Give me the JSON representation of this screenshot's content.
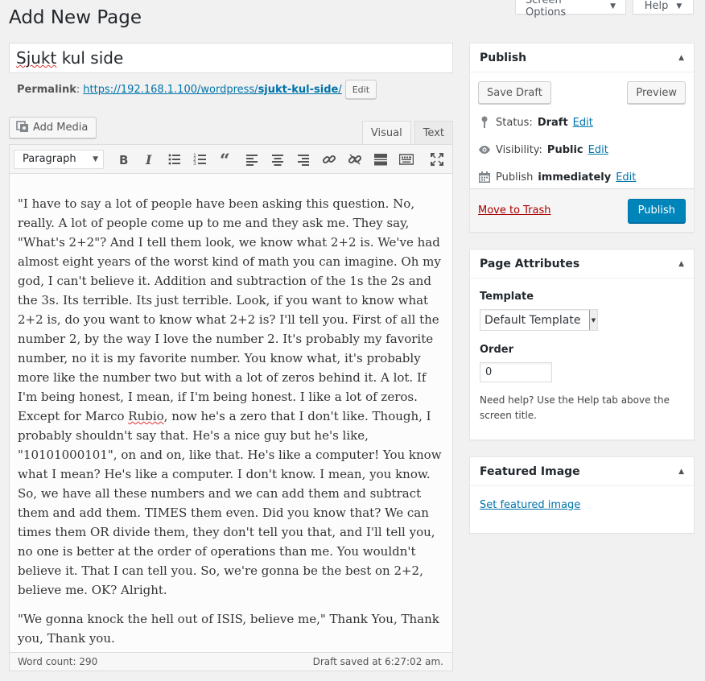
{
  "screen_meta": {
    "screen_options_label": "Screen Options",
    "help_label": "Help"
  },
  "page": {
    "heading": "Add New Page"
  },
  "title": {
    "value_word1": "Sjukt",
    "value_rest": " kul side"
  },
  "permalink": {
    "label": "Permalink",
    "url_base": "https://192.168.1.100/wordpress/",
    "slug": "sjukt-kul-side",
    "url_tail": "/",
    "edit_label": "Edit"
  },
  "media": {
    "add_media_label": "Add Media"
  },
  "editor_tabs": {
    "visual": "Visual",
    "text": "Text"
  },
  "toolbar": {
    "format_value": "Paragraph",
    "buttons": [
      "bold",
      "italic",
      "bulleted-list",
      "numbered-list",
      "blockquote",
      "align-left",
      "align-center",
      "align-right",
      "insert-link",
      "remove-link",
      "read-more",
      "toolbar-toggle",
      "fullscreen"
    ]
  },
  "content": {
    "p1_part1": "\"I have to say a lot of people have been asking this question. No, really. A lot of people come up to me and they ask me. They say, \"What's 2+2\"? And I tell them look, we know what 2+2 is. We've had almost eight years of the worst kind of math you can imagine. Oh my god, I can't believe it. Addition and subtraction of the 1s the 2s and the 3s. Its terrible. Its just terrible. Look, if you want to know what 2+2 is, do you want to know what 2+2 is? I'll tell you. First of all the number 2, by the way I love the number 2. It's probably my favorite number, no it is my favorite number. You know what, it's probably more like the number two but with a lot of zeros behind it. A lot. If I'm being honest, I mean, if I'm being honest. I like a lot of zeros. Except for Marco ",
    "p1_spell": "Rubio",
    "p1_part2": ", now he's a zero that I don't like. Though, I probably shouldn't say that. He's a nice guy but he's like, \"10101000101\", on and on, like that. He's like a computer! You know what I mean? He's like a computer. I don't know. I mean, you know. So, we have all these numbers and we can add them and subtract them and add them. TIMES them even. Did you know that? We can times them OR divide them, they don't tell you that, and I'll tell you, no one is better at the order of operations than me. You wouldn't believe it. That I can tell you. So, we're gonna be the best on 2+2, believe me. OK? Alright.",
    "p2": "\"We gonna knock the hell out of ISIS, believe me,\" Thank You, Thank you, Thank you."
  },
  "status_bar": {
    "word_count": "Word count: 290",
    "draft_saved": "Draft saved at 6:27:02 am."
  },
  "publish": {
    "title": "Publish",
    "save_draft": "Save Draft",
    "preview": "Preview",
    "status_label": "Status:",
    "status_value": "Draft",
    "visibility_label": "Visibility:",
    "visibility_value": "Public",
    "publish_label": "Publish",
    "publish_value": "immediately",
    "edit": "Edit",
    "move_to_trash": "Move to Trash",
    "publish_button": "Publish"
  },
  "attributes": {
    "title": "Page Attributes",
    "template_label": "Template",
    "template_value": "Default Template",
    "order_label": "Order",
    "order_value": "0",
    "help": "Need help? Use the Help tab above the screen title."
  },
  "featured": {
    "title": "Featured Image",
    "link": "Set featured image"
  },
  "colors": {
    "primary": "#0085ba",
    "link": "#0073aa",
    "trash": "#a00"
  }
}
